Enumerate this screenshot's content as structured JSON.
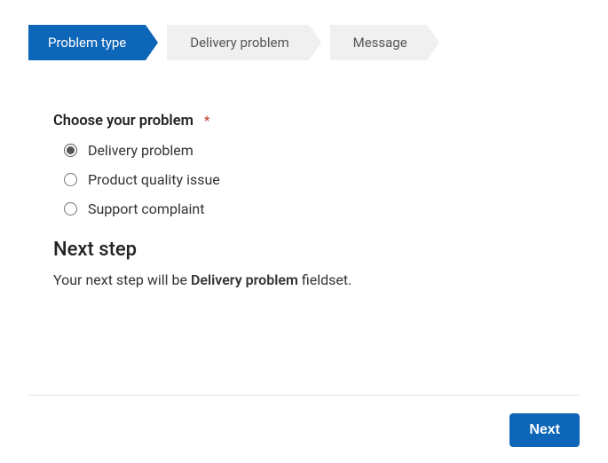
{
  "breadcrumb": {
    "steps": [
      {
        "label": "Problem type",
        "active": true
      },
      {
        "label": "Delivery problem",
        "active": false
      },
      {
        "label": "Message",
        "active": false
      }
    ]
  },
  "form": {
    "question_label": "Choose your problem",
    "required_asterisk": "*",
    "options": [
      {
        "label": "Delivery problem",
        "selected": true
      },
      {
        "label": "Product quality issue",
        "selected": false
      },
      {
        "label": "Support complaint",
        "selected": false
      }
    ]
  },
  "next_step": {
    "heading": "Next step",
    "prefix": "Your next step will be ",
    "bold": "Delivery problem",
    "suffix": " fieldset."
  },
  "footer": {
    "next_label": "Next"
  }
}
